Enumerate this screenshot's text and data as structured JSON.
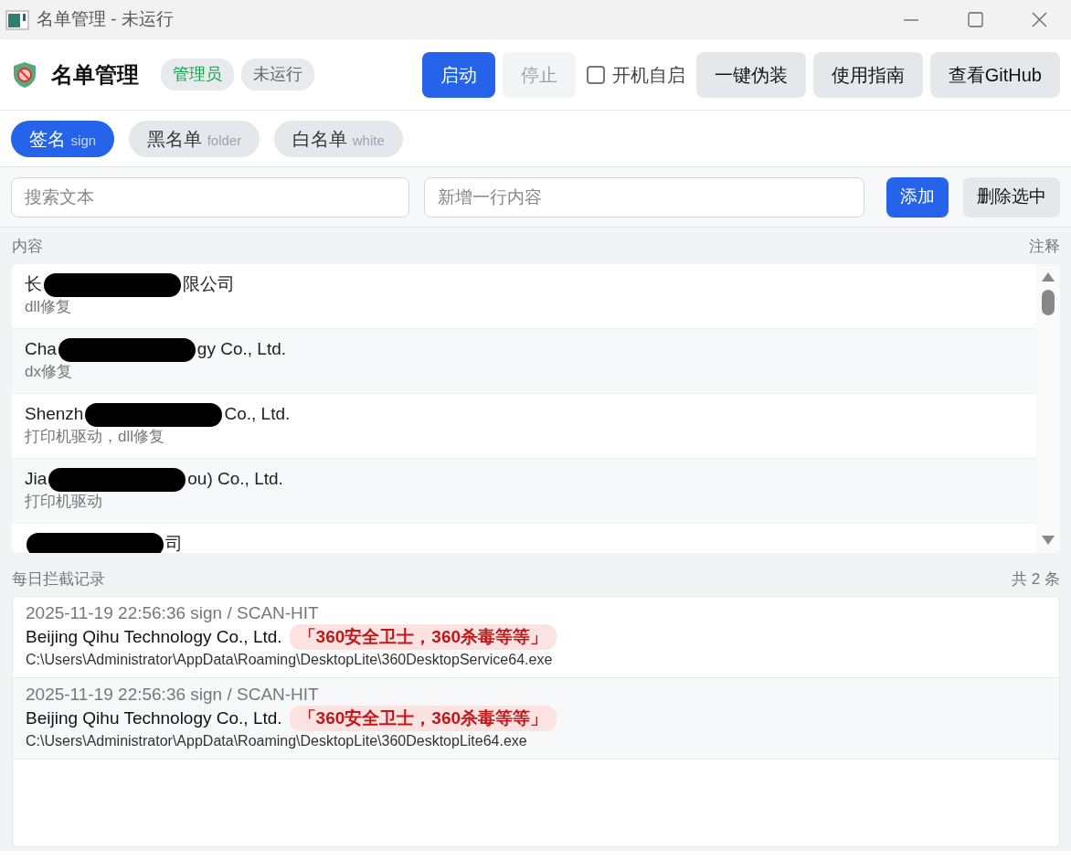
{
  "window": {
    "title": "名单管理 - 未运行"
  },
  "header": {
    "title": "名单管理",
    "badges": [
      {
        "text": "管理员",
        "kind": "admin"
      },
      {
        "text": "未运行",
        "kind": "status"
      }
    ],
    "buttons": [
      {
        "label": "启动",
        "disabled": false
      },
      {
        "label": "停止",
        "disabled": true
      }
    ],
    "autostart": {
      "label": "开机自启",
      "checked": false
    },
    "actions": [
      "一键伪装",
      "使用指南",
      "查看GitHub"
    ]
  },
  "tabs": [
    {
      "label": "签名",
      "sub": "sign",
      "selected": true
    },
    {
      "label": "黑名单",
      "sub": "folder",
      "selected": false
    },
    {
      "label": "白名单",
      "sub": "white",
      "selected": false
    }
  ],
  "toolbar": {
    "search": {
      "placeholder": "搜索文本"
    },
    "new_line": {
      "placeholder": "新增一行内容"
    },
    "add_button": "添加",
    "delete_button": "删除选中"
  },
  "list": {
    "columns": [
      "内容",
      "注释"
    ],
    "rows": [
      {
        "segments": [
          {
            "kind": "text",
            "text": "长"
          },
          {
            "kind": "redaction"
          },
          {
            "kind": "text",
            "text": "限公司"
          }
        ],
        "note": "dll修复"
      },
      {
        "segments": [
          {
            "kind": "text",
            "text": "Cha"
          },
          {
            "kind": "redaction"
          },
          {
            "kind": "text",
            "text": "gy Co., Ltd."
          }
        ],
        "note": "dx修复"
      },
      {
        "segments": [
          {
            "kind": "text",
            "text": "Shenzh"
          },
          {
            "kind": "redaction"
          },
          {
            "kind": "text",
            "text": "Co., Ltd."
          }
        ],
        "note": "打印机驱动，dll修复"
      },
      {
        "segments": [
          {
            "kind": "text",
            "text": "Jia"
          },
          {
            "kind": "redaction"
          },
          {
            "kind": "text",
            "text": "ou) Co., Ltd."
          }
        ],
        "note": "打印机驱动"
      },
      {
        "segments": [
          {
            "kind": "redaction"
          },
          {
            "kind": "text",
            "text": "司"
          }
        ]
      }
    ]
  },
  "log": {
    "title": "每日拦截记录",
    "count": "共 2 条",
    "entries": [
      {
        "meta": "2025-11-19 22:56:36 sign / SCAN-HIT",
        "name": "Beijing Qihu Technology Co., Ltd.",
        "tag": "「360安全卫士，360杀毒等等」",
        "path": "C:\\Users\\Administrator\\AppData\\Roaming\\DesktopLite\\360DesktopService64.exe"
      },
      {
        "meta": "2025-11-19 22:56:36 sign / SCAN-HIT",
        "name": "Beijing Qihu Technology Co., Ltd.",
        "tag": "「360安全卫士，360杀毒等等」",
        "path": "C:\\Users\\Administrator\\AppData\\Roaming\\DesktopLite\\360DesktopLite64.exe"
      }
    ]
  }
}
